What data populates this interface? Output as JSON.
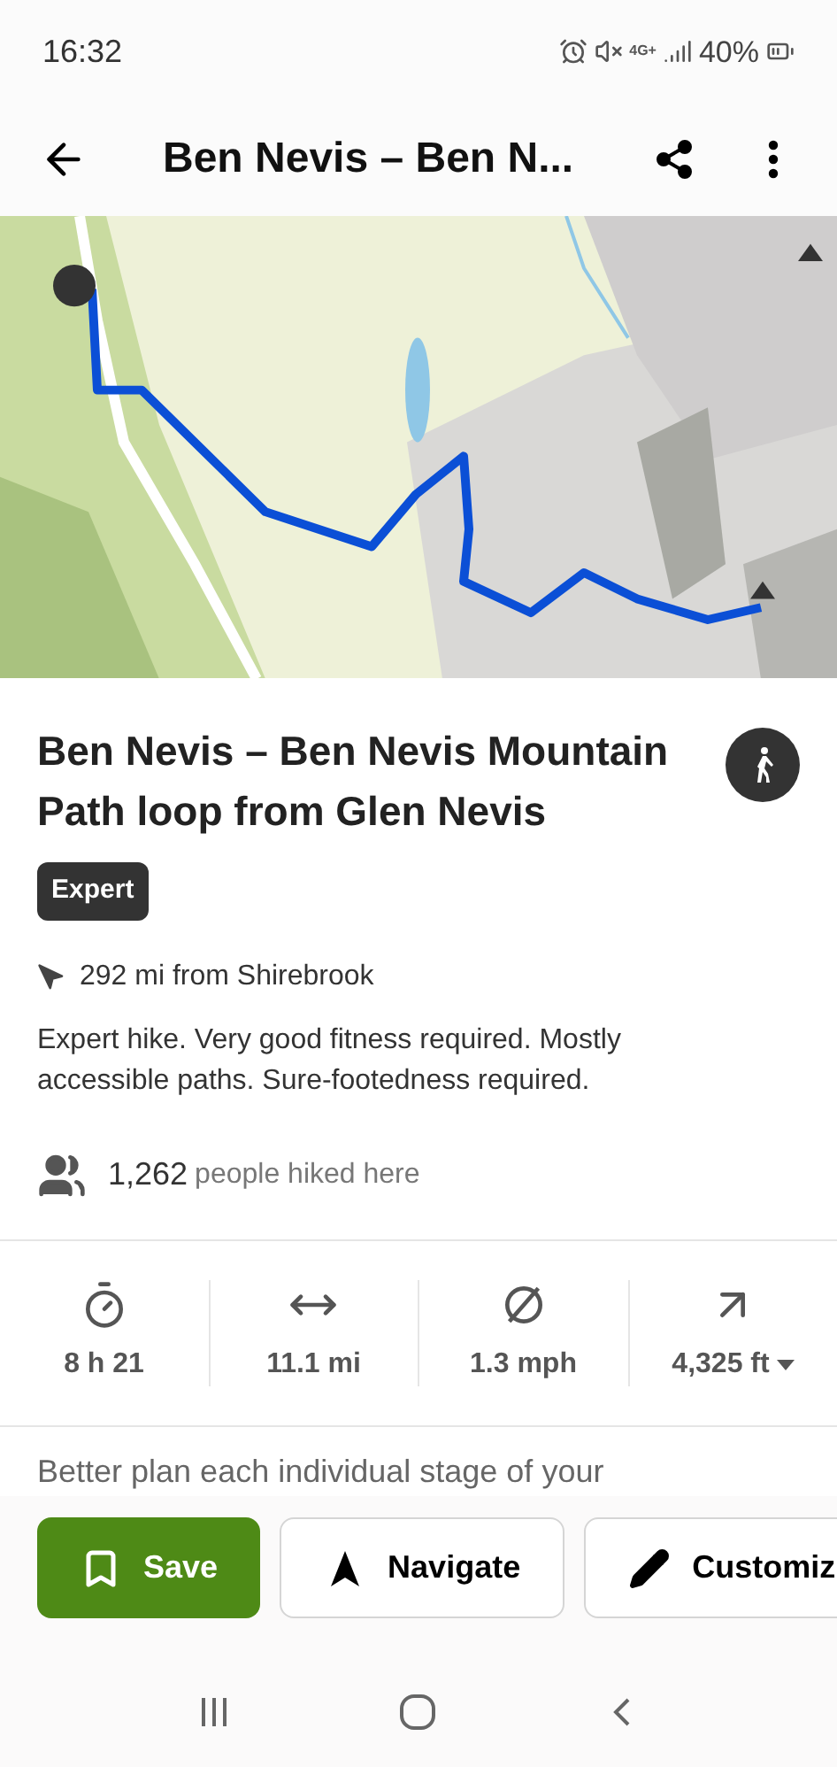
{
  "status_bar": {
    "time": "16:32",
    "battery": "40%",
    "network": "4G+"
  },
  "toolbar": {
    "title": "Ben Nevis – Ben N..."
  },
  "tour": {
    "title": "Ben Nevis – Ben Nevis Mountain Path loop from Glen Nevis",
    "difficulty": "Expert",
    "distance_from": "292 mi from Shirebrook",
    "description": "Expert hike. Very good fitness required. Mostly accessible paths. Sure-footedness required.",
    "count": "1,262",
    "count_label": "people hiked here"
  },
  "stats": [
    {
      "kind": "duration",
      "value": "8 h 21"
    },
    {
      "kind": "distance",
      "value": "11.1 mi"
    },
    {
      "kind": "speed",
      "value": "1.3 mph"
    },
    {
      "kind": "ascent",
      "value": "4,325 ft",
      "dropdown": true
    }
  ],
  "teaser": "Better plan each individual stage of your",
  "actions": [
    {
      "kind": "save",
      "label": "Save",
      "primary": true
    },
    {
      "kind": "navigate",
      "label": "Navigate",
      "primary": false
    },
    {
      "kind": "customize",
      "label": "Customiz",
      "primary": false
    }
  ]
}
